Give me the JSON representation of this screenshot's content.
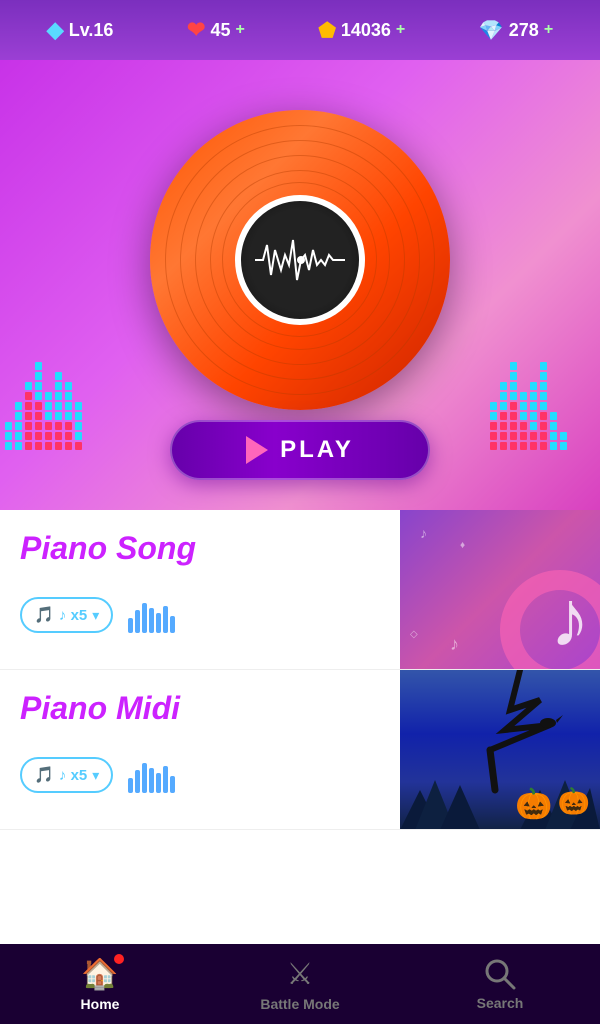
{
  "topbar": {
    "level": "Lv.16",
    "hearts": "45",
    "coins": "14036",
    "gems": "278",
    "plus": "+"
  },
  "hero": {
    "play_label": "PLAY"
  },
  "songs": [
    {
      "title": "Piano Song",
      "tickets": "♪ x5",
      "thumb_type": "music"
    },
    {
      "title": "Piano Midi",
      "tickets": "♪ x5",
      "thumb_type": "halloween"
    }
  ],
  "nav": {
    "home": "Home",
    "battle": "Battle Mode",
    "search": "Search"
  }
}
